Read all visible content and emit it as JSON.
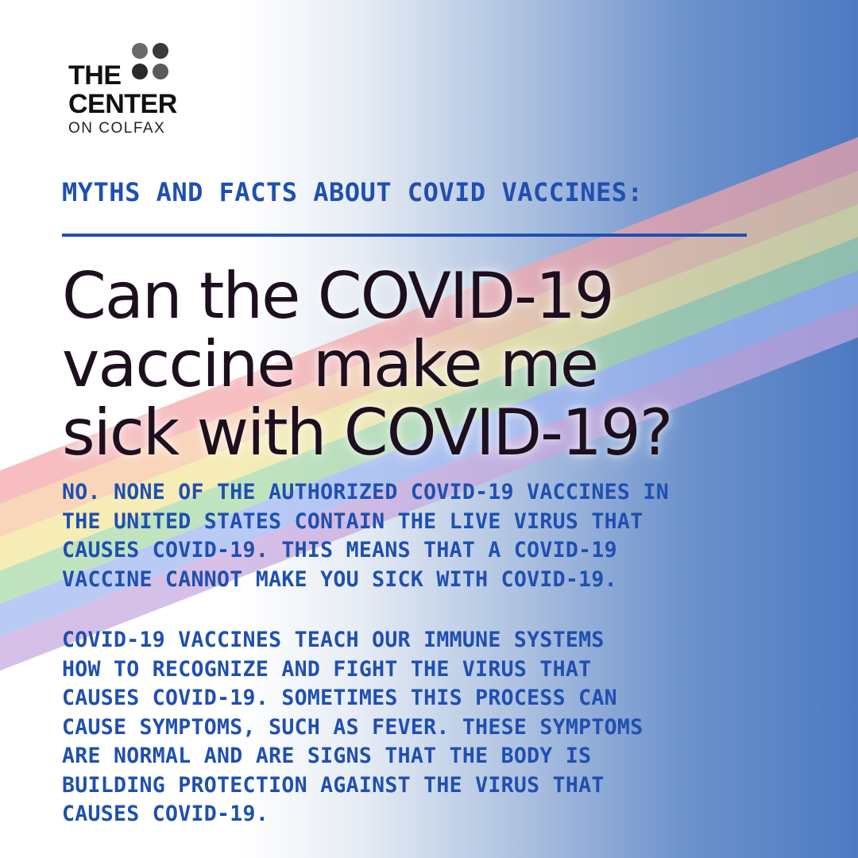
{
  "logo": {
    "line1": "THE",
    "line2": "CENTER",
    "line3": "ON COLFAX",
    "dot_colors": [
      "#6a6a6a",
      "#3a3a3a",
      "#2a2a2a",
      "#5a5a5a"
    ]
  },
  "kicker": "MYTHS AND FACTS ABOUT COVID VACCINES:",
  "headline": {
    "line1": "Can the COVID-19",
    "line2": "vaccine make me",
    "line3": "sick with COVID-19?"
  },
  "answer": {
    "para1": [
      "NO. NONE OF THE AUTHORIZED COVID-19 VACCINES IN",
      "THE UNITED STATES CONTAIN THE LIVE VIRUS THAT",
      "CAUSES COVID-19. THIS MEANS THAT A COVID-19",
      "VACCINE CANNOT MAKE YOU SICK WITH COVID-19."
    ],
    "para2": [
      "COVID-19 VACCINES TEACH OUR IMMUNE SYSTEMS",
      "HOW TO RECOGNIZE AND FIGHT THE VIRUS THAT",
      "CAUSES COVID-19. SOMETIMES THIS PROCESS CAN",
      "CAUSE SYMPTOMS, SUCH AS FEVER. THESE SYMPTOMS",
      "ARE NORMAL AND ARE SIGNS THAT THE BODY IS",
      "BUILDING PROTECTION AGAINST THE VIRUS THAT",
      "CAUSES COVID-19."
    ]
  },
  "colors": {
    "accent_blue": "#1f4fb0",
    "headline_dark": "#1e0f1f",
    "rainbow": [
      "#f4a5a8",
      "#f7c6a0",
      "#f2e69a",
      "#a9d9a8",
      "#9fb7f2",
      "#c7a8df"
    ]
  }
}
